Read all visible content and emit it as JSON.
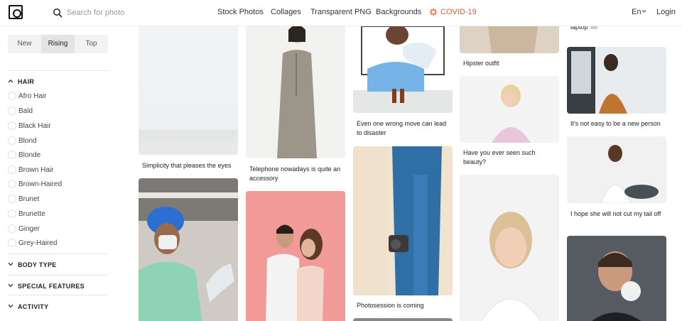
{
  "header": {
    "search_placeholder": "Search for photo",
    "nav": [
      {
        "label": "Stock Photos"
      },
      {
        "label": "Collages"
      },
      {
        "label": "Transparent PNG"
      },
      {
        "label": "Backgrounds"
      },
      {
        "label": "COVID-19"
      }
    ],
    "language": "En",
    "login": "Login"
  },
  "sidebar": {
    "sort_tabs": [
      {
        "label": "New"
      },
      {
        "label": "Rising"
      },
      {
        "label": "Top"
      }
    ],
    "sections": [
      {
        "title": "HAIR"
      },
      {
        "title": "BODY TYPE"
      },
      {
        "title": "SPECIAL FEATURES"
      },
      {
        "title": "ACTIVITY"
      }
    ],
    "hair_options": [
      {
        "label": "Afro Hair"
      },
      {
        "label": "Bald"
      },
      {
        "label": "Black Hair"
      },
      {
        "label": "Blond"
      },
      {
        "label": "Blonde"
      },
      {
        "label": "Brown Hair"
      },
      {
        "label": "Brown-Haired"
      },
      {
        "label": "Brunet"
      },
      {
        "label": "Brunette"
      },
      {
        "label": "Ginger"
      },
      {
        "label": "Grey-Haired"
      }
    ]
  },
  "grid": {
    "captions": [
      "Simplicity that pleases the eyes",
      "Telephone nowadays is quite an accessory",
      "Even one wrong move can lead to disaster",
      "Photosession is coming",
      "Hipster outfit",
      "Have you ever seen such beauty?",
      "laptop",
      "It's not easy to be a new person",
      "I hope she will not cut my tail off"
    ]
  },
  "colors": {
    "covid_accent": "#e05b2b",
    "active_tab_bg": "#e4e4e4"
  }
}
